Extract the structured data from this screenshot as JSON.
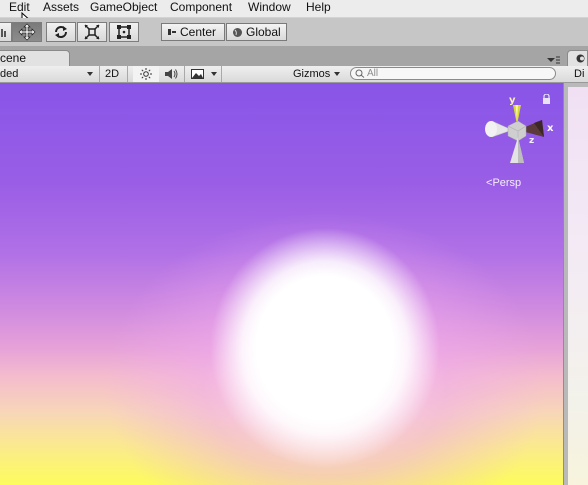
{
  "menu": [
    "Edit",
    "Assets",
    "GameObject",
    "Component",
    "Window",
    "Help"
  ],
  "toolbar": {
    "pivot_label": "Center",
    "space_label": "Global"
  },
  "tabs": {
    "scene": "cene"
  },
  "scene_controls": {
    "shading_mode": "ded",
    "mode_2d": "2D",
    "gizmos": "Gizmos",
    "search_placeholder": "All"
  },
  "right_panel": {
    "header": "Di"
  },
  "viewport": {
    "projection": "Persp",
    "axes": {
      "y": "y",
      "x": "x",
      "z": "z"
    }
  },
  "colors": {
    "sky_top": "#8855e8",
    "horizon_bottom": "#fcfc5c",
    "sun": "#ffffff",
    "gizmo_x": "#c7452b",
    "gizmo_y": "#d8d83a"
  }
}
